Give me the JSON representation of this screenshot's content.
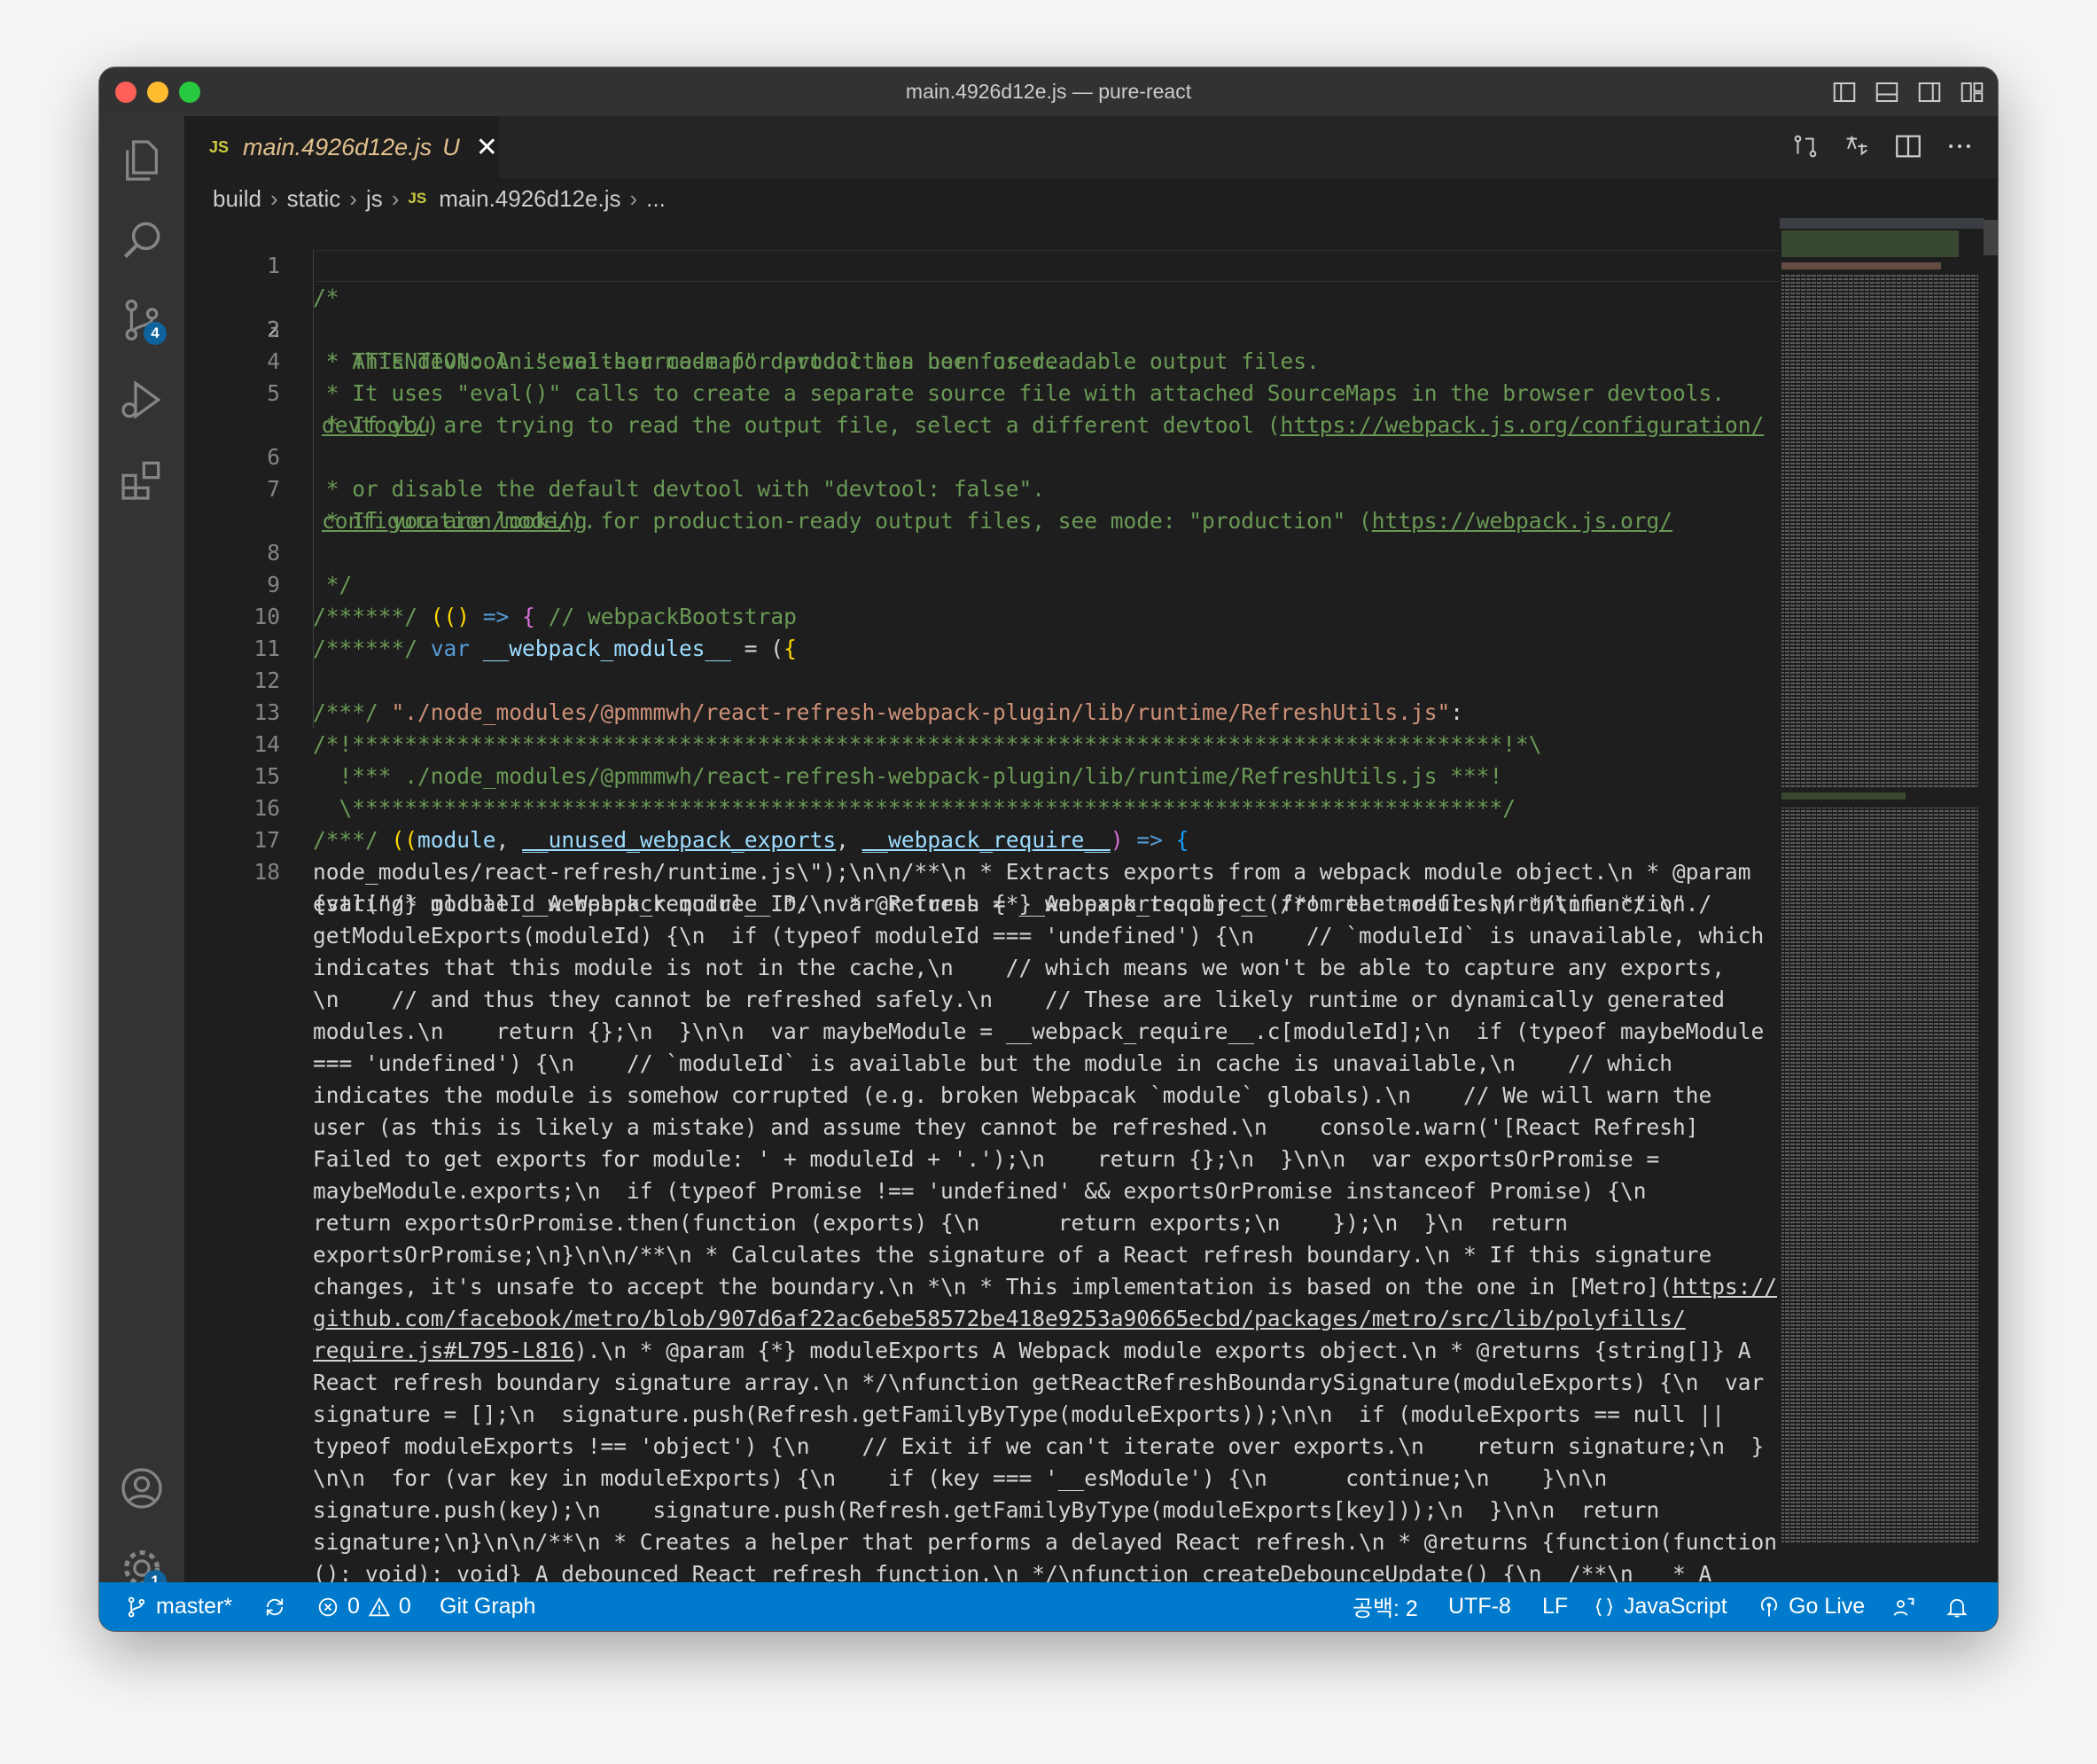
{
  "window": {
    "title": "main.4926d12e.js — pure-react"
  },
  "activity_bar": {
    "source_control_badge": "4",
    "settings_badge": "1"
  },
  "tab": {
    "icon": "JS",
    "name": "main.4926d12e.js",
    "modified": "U",
    "close": "✕"
  },
  "breadcrumb": [
    "build",
    "static",
    "js",
    "main.4926d12e.js",
    "..."
  ],
  "lines": [
    {
      "n": "1",
      "t": "/*"
    },
    {
      "n": "2",
      "t": " * ATTENTION: An \"eval-source-map\" devtool has been used."
    },
    {
      "n": "3",
      "t": " * This devtool is neither made for production nor for readable output files."
    },
    {
      "n": "4",
      "t": " * It uses \"eval()\" calls to create a separate source file with attached SourceMaps in the browser devtools."
    },
    {
      "n": "5",
      "t": " * If you are trying to read the output file, select a different devtool ("
    },
    {
      "n": "5u",
      "t": "https://webpack.js.org/configuration/"
    },
    {
      "n": "5w",
      "t": "devtool/"
    },
    {
      "n": "5x",
      "t": ")"
    },
    {
      "n": "6",
      "t": " * or disable the default devtool with \"devtool: false\"."
    },
    {
      "n": "7",
      "t": " * If you are looking for production-ready output files, see mode: \"production\" ("
    },
    {
      "n": "7u",
      "t": "https://webpack.js.org/"
    },
    {
      "n": "7w",
      "t": "configuration/mode/"
    },
    {
      "n": "7x",
      "t": ")."
    },
    {
      "n": "8",
      "t": " */"
    },
    {
      "n": "9a",
      "t": "/******/ "
    },
    {
      "n": "9b",
      "t": "(() "
    },
    {
      "n": "9c",
      "t": "=> "
    },
    {
      "n": "9d",
      "t": "{ "
    },
    {
      "n": "9e",
      "t": "// webpackBootstrap"
    },
    {
      "n": "10a",
      "t": "/******/ "
    },
    {
      "n": "10b",
      "t": "var "
    },
    {
      "n": "10c",
      "t": "__webpack_modules__"
    },
    {
      "n": "10d",
      "t": " = ("
    },
    {
      "n": "10e",
      "t": "{"
    },
    {
      "n": "12a",
      "t": "/***/ "
    },
    {
      "n": "12b",
      "t": "\"./node_modules/@pmmmwh/react-refresh-webpack-plugin/lib/runtime/RefreshUtils.js\""
    },
    {
      "n": "12c",
      "t": ":"
    },
    {
      "n": "13",
      "t": "/*!****************************************************************************************!*\\"
    },
    {
      "n": "14",
      "t": "  !*** ./node_modules/@pmmmwh/react-refresh-webpack-plugin/lib/runtime/RefreshUtils.js ***!"
    },
    {
      "n": "15",
      "t": "  \\****************************************************************************************/"
    },
    {
      "n": "16a",
      "t": "/***/ "
    },
    {
      "n": "16b",
      "t": "(("
    },
    {
      "n": "16c",
      "t": "module"
    },
    {
      "n": "16d",
      "t": ", "
    },
    {
      "n": "16e",
      "t": "__unused_webpack_exports"
    },
    {
      "n": "16f",
      "t": ", "
    },
    {
      "n": "16g",
      "t": "__webpack_require__"
    },
    {
      "n": "16h",
      "t": ") "
    },
    {
      "n": "16i",
      "t": "=> "
    },
    {
      "n": "16j",
      "t": "{"
    }
  ],
  "line_numbers": [
    "1",
    "2",
    "3",
    "4",
    "5",
    "6",
    "7",
    "8",
    "9",
    "10",
    "11",
    "12",
    "13",
    "14",
    "15",
    "16",
    "17",
    "18"
  ],
  "eval_lines": [
    "eval(\"/* global __webpack_require__ */\\nvar Refresh = __webpack_require__(/*! react-refresh/runtime */ \\\"./",
    "node_modules/react-refresh/runtime.js\\\");\\n\\n/**\\n * Extracts exports from a webpack module object.\\n * @param",
    "{string} moduleId A Webpack module ID.\\n * @returns {*} An exports object from the module.\\n */\\nfunction",
    "getModuleExports(moduleId) {\\n  if (typeof moduleId === 'undefined') {\\n    // `moduleId` is unavailable, which",
    "indicates that this module is not in the cache,\\n    // which means we won't be able to capture any exports,",
    "\\n    // and thus they cannot be refreshed safely.\\n    // These are likely runtime or dynamically generated",
    "modules.\\n    return {};\\n  }\\n\\n  var maybeModule = __webpack_require__.c[moduleId];\\n  if (typeof maybeModule",
    "=== 'undefined') {\\n    // `moduleId` is available but the module in cache is unavailable,\\n    // which",
    "indicates the module is somehow corrupted (e.g. broken Webpacak `module` globals).\\n    // We will warn the",
    "user (as this is likely a mistake) and assume they cannot be refreshed.\\n    console.warn('[React Refresh]",
    "Failed to get exports for module: ' + moduleId + '.');\\n    return {};\\n  }\\n\\n  var exportsOrPromise =",
    "maybeModule.exports;\\n  if (typeof Promise !== 'undefined' && exportsOrPromise instanceof Promise) {\\n",
    "return exportsOrPromise.then(function (exports) {\\n      return exports;\\n    });\\n  }\\n  return",
    "exportsOrPromise;\\n}\\n\\n/**\\n * Calculates the signature of a React refresh boundary.\\n * If this signature",
    "changes, it's unsafe to accept the boundary.\\n *\\n * This implementation is based on the one in [Metro](",
    "github.com/facebook/metro/blob/907d6af22ac6ebe58572be418e9253a90665ecbd/packages/metro/src/lib/polyfills/",
    "require.js#L795-L816",
    ").\\n * @param {*} moduleExports A Webpack module exports object.\\n * @returns {string[]} A",
    "React refresh boundary signature array.\\n */\\nfunction getReactRefreshBoundarySignature(moduleExports) {\\n  var",
    "signature = [];\\n  signature.push(Refresh.getFamilyByType(moduleExports));\\n\\n  if (moduleExports == null ||",
    "typeof moduleExports !== 'object') {\\n    // Exit if we can't iterate over exports.\\n    return signature;\\n  }",
    "\\n\\n  for (var key in moduleExports) {\\n    if (key === '__esModule') {\\n      continue;\\n    }\\n\\n",
    "signature.push(key);\\n    signature.push(Refresh.getFamilyByType(moduleExports[key]));\\n  }\\n\\n  return",
    "signature;\\n}\\n\\n/**\\n * Creates a helper that performs a delayed React refresh.\\n * @returns {function(function",
    "(): void): void} A debounced React refresh function.\\n */\\nfunction createDebounceUpdate() {\\n  /**\\n   * A"
  ],
  "eval_link_start": "https://",
  "statusbar": {
    "branch": "master*",
    "errors": "0",
    "warnings": "0",
    "git_graph": "Git Graph",
    "spaces": "공백: 2",
    "encoding": "UTF-8",
    "eol": "LF",
    "language": "JavaScript",
    "go_live": "Go Live"
  },
  "colors": {
    "accent": "#007acc",
    "editor_bg": "#1e1e1e",
    "comment": "#6a9955",
    "string": "#ce9178"
  }
}
